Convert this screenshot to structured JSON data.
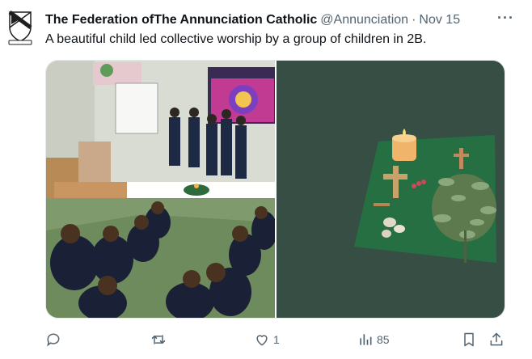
{
  "tweet": {
    "display_name": "The Federation ofThe Annunciation Catholic",
    "handle": "@Annunciation",
    "separator": "·",
    "timestamp": "Nov 15",
    "text": "A beautiful child led collective worship by a group of children in 2B.",
    "more_label": "···"
  },
  "actions": {
    "reply_count": "",
    "retweet_count": "",
    "like_count": "1",
    "views_count": "85"
  },
  "icons": [
    "crest-icon",
    "reply-icon",
    "retweet-icon",
    "heart-icon",
    "views-icon",
    "bookmark-icon",
    "share-icon"
  ],
  "colors": {
    "secondary_text": "#536471",
    "primary_text": "#0f1419",
    "divider": "#e6e9ea"
  }
}
